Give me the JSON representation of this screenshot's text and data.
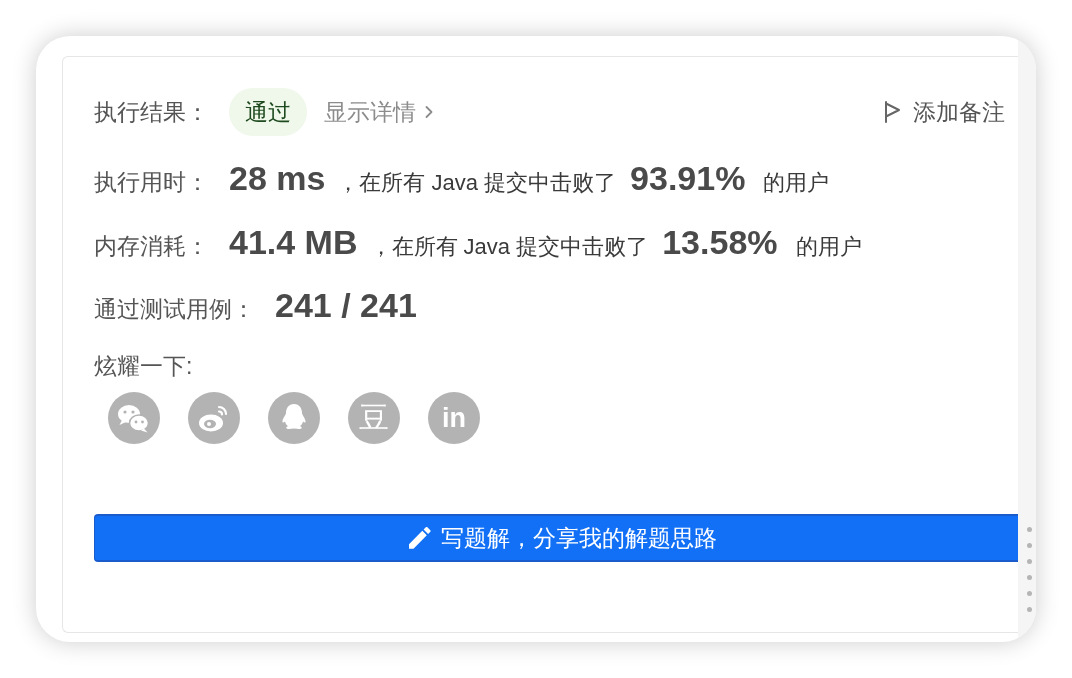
{
  "result": {
    "label": "执行结果：",
    "status": {
      "text": "通过",
      "kind": "accepted"
    },
    "details_link": "显示详情",
    "note_button": "添加备注"
  },
  "metrics": [
    {
      "label": "执行用时：",
      "value": "28 ms",
      "comparison": "，在所有 Java 提交中击败了",
      "percent": "93.91%",
      "suffix": "的用户"
    },
    {
      "label": "内存消耗：",
      "value": "41.4 MB",
      "comparison": "，在所有 Java 提交中击败了",
      "percent": "13.58%",
      "suffix": "的用户"
    }
  ],
  "test_cases": {
    "label": "通过测试用例：",
    "value": "241 / 241"
  },
  "share": {
    "label": "炫耀一下:",
    "buttons": [
      {
        "kind": "bubbles"
      },
      {
        "kind": "eye"
      },
      {
        "kind": "penguin"
      },
      {
        "kind": "glyph",
        "glyph": "豆"
      },
      {
        "kind": "glyph",
        "glyph": "in"
      }
    ]
  },
  "write_solution_button": {
    "label": "写题解，分享我的解题思路"
  }
}
